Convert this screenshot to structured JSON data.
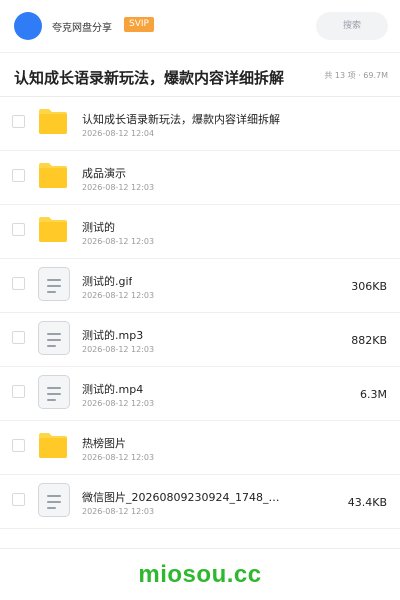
{
  "header": {
    "brand_name": "夸克网盘分享",
    "vip_label": "SVIP",
    "search_label": "搜索"
  },
  "folder": {
    "title": "认知成长语录新玩法，爆款内容详细拆解",
    "meta": "共 13 项 · 69.7M"
  },
  "files": [
    {
      "type": "folder",
      "name": "认知成长语录新玩法，爆款内容详细拆解",
      "date": "2026-08-12 12:04",
      "size": ""
    },
    {
      "type": "folder",
      "name": "成品演示",
      "date": "2026-08-12 12:03",
      "size": ""
    },
    {
      "type": "folder",
      "name": "测试的",
      "date": "2026-08-12 12:03",
      "size": ""
    },
    {
      "type": "file",
      "name": "测试的.gif",
      "date": "2026-08-12 12:03",
      "size": "306KB"
    },
    {
      "type": "file",
      "name": "测试的.mp3",
      "date": "2026-08-12 12:03",
      "size": "882KB"
    },
    {
      "type": "file",
      "name": "测试的.mp4",
      "date": "2026-08-12 12:03",
      "size": "6.3M"
    },
    {
      "type": "folder",
      "name": "热榜图片",
      "date": "2026-08-12 12:03",
      "size": ""
    },
    {
      "type": "file",
      "name": "微信图片_20260809230924_1748_…",
      "date": "2026-08-12 12:03",
      "size": "43.4KB"
    }
  ],
  "footer": {
    "watermark": "miosou.cc"
  },
  "colors": {
    "avatar": "#2f7cf6",
    "vip_badge": "#f7a23b",
    "folder_icon": "#ffc928",
    "watermark": "#2eb82e"
  }
}
